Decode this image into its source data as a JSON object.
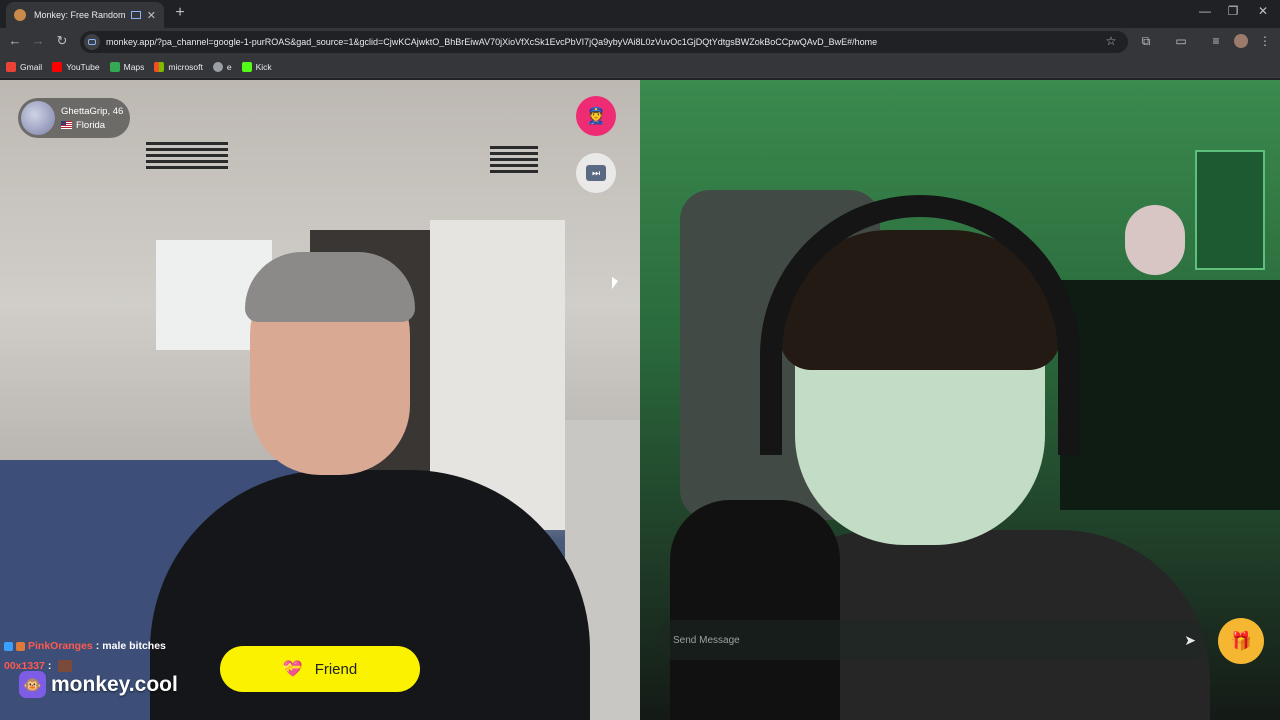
{
  "browser": {
    "tab_title": "Monkey: Free Random Vide",
    "tab_close": "✕",
    "new_tab": "+",
    "window_controls": [
      "—",
      "❐",
      "✕"
    ],
    "url": "monkey.app/?pa_channel=google-1-purROAS&gad_source=1&gclid=CjwKCAjwktO_BhBrEiwAV70jXioVfXcSk1EvcPbVI7jQa9ybyVAi8L0zVuvOc1GjDQtYdtgsBWZokBoCCpwQAvD_BwE#/home",
    "bookmarks": [
      {
        "label": "Gmail",
        "color": "#ea4335"
      },
      {
        "label": "YouTube",
        "color": "#ff0000"
      },
      {
        "label": "Maps",
        "color": "#34a853"
      },
      {
        "label": "microsoft",
        "color": "#f25022"
      },
      {
        "label": "e",
        "color": "#9aa0a6"
      },
      {
        "label": "Kick",
        "color": "#53fc18"
      }
    ]
  },
  "partner": {
    "name": "GhettaGrip, 46",
    "location": "Florida"
  },
  "controls": {
    "report_icon": "👮",
    "skip_icon": "⏭",
    "friend_label": "Friend",
    "heart_icon": "💝",
    "gift_icon": "🎁",
    "send_icon": "➤"
  },
  "chat": {
    "line1_user": "PinkOranges",
    "line1_text": "male bitches",
    "line2_user": "00x1337",
    "sep": ":"
  },
  "brand": {
    "logo": "🐵",
    "text": "monkey.cool"
  },
  "message": {
    "placeholder": "Send Message"
  },
  "colors": {
    "accent_yellow": "#fbf200",
    "report_pink": "#ef2b73",
    "gift_orange": "#f5b731",
    "brand_purple": "#7d5ce6"
  }
}
